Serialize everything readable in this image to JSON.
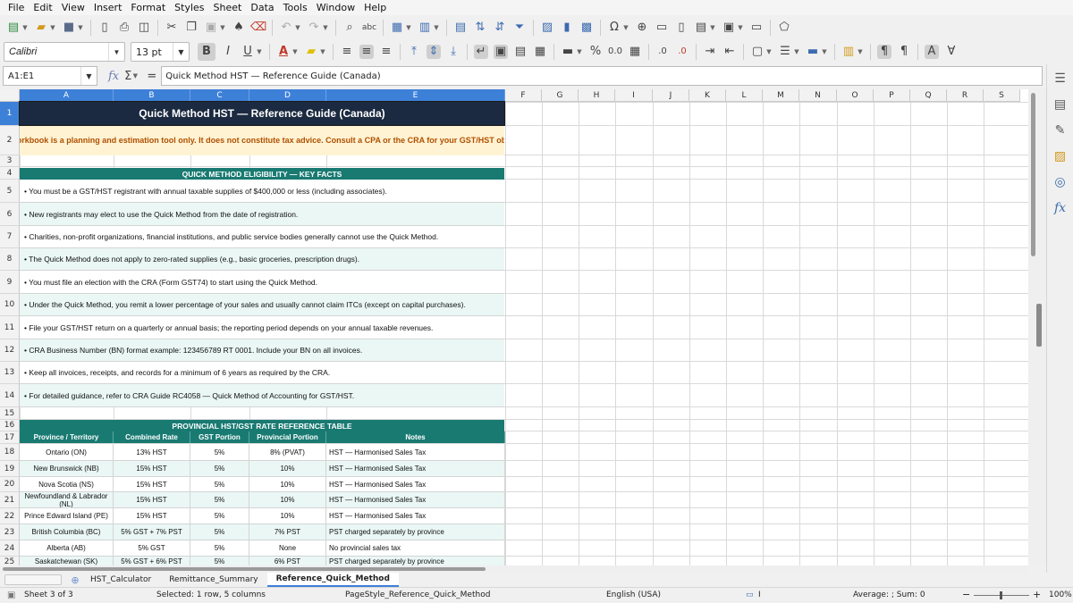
{
  "menu": [
    "File",
    "Edit",
    "View",
    "Insert",
    "Format",
    "Styles",
    "Sheet",
    "Data",
    "Tools",
    "Window",
    "Help"
  ],
  "toolbar": {
    "font_name": "Calibri",
    "font_size": "13 pt",
    "bold_label": "B",
    "italic_label": "I",
    "underline_label": "U",
    "percent_label": "%",
    "decimal_label": "0.0"
  },
  "formula_bar": {
    "cell_ref": "A1:E1",
    "content": "Quick Method HST — Reference Guide (Canada)"
  },
  "columns": [
    "A",
    "B",
    "C",
    "D",
    "E",
    "F",
    "G",
    "H",
    "I",
    "J",
    "K",
    "L",
    "M",
    "N",
    "O",
    "P",
    "Q",
    "R",
    "S"
  ],
  "rows": [
    "1",
    "2",
    "3",
    "4",
    "5",
    "6",
    "7",
    "8",
    "9",
    "10",
    "11",
    "12",
    "13",
    "14",
    "15",
    "16",
    "17",
    "18",
    "19",
    "20",
    "21",
    "22",
    "23",
    "24",
    "25"
  ],
  "sheet": {
    "title": "Quick Method HST — Reference Guide (Canada)",
    "warning": "⚠  This workbook is a planning and estimation tool only. It does not constitute tax advice. Consult a CPA or the CRA for your GST/HST obligations.",
    "eligibility_heading": "QUICK METHOD ELIGIBILITY — KEY FACTS",
    "eligibility": [
      "• You must be a GST/HST registrant with annual taxable supplies of $400,000 or less (including associates).",
      "• New registrants may elect to use the Quick Method from the date of registration.",
      "• Charities, non-profit organizations, financial institutions, and public service bodies generally cannot use the Quick Method.",
      "• The Quick Method does not apply to zero-rated supplies (e.g., basic groceries, prescription drugs).",
      "• You must file an election with the CRA (Form GST74) to start using the Quick Method.",
      "• Under the Quick Method, you remit a lower percentage of your sales and usually cannot claim ITCs (except on capital purchases).",
      "• File your GST/HST return on a quarterly or annual basis; the reporting period depends on your annual taxable revenues.",
      "• CRA Business Number (BN) format example: 123456789 RT 0001. Include your BN on all invoices.",
      "• Keep all invoices, receipts, and records for a minimum of 6 years as required by the CRA.",
      "• For detailed guidance, refer to CRA Guide RC4058 — Quick Method of Accounting for GST/HST."
    ],
    "rate_heading": "PROVINCIAL HST/GST RATE REFERENCE TABLE",
    "rate_headers": [
      "Province / Territory",
      "Combined Rate",
      "GST Portion",
      "Provincial Portion",
      "Notes"
    ],
    "rate_rows": [
      [
        "Ontario (ON)",
        "13% HST",
        "5%",
        "8% (PVAT)",
        "HST — Harmonised Sales Tax"
      ],
      [
        "New Brunswick (NB)",
        "15% HST",
        "5%",
        "10%",
        "HST — Harmonised Sales Tax"
      ],
      [
        "Nova Scotia (NS)",
        "15% HST",
        "5%",
        "10%",
        "HST — Harmonised Sales Tax"
      ],
      [
        "Newfoundland & Labrador (NL)",
        "15% HST",
        "5%",
        "10%",
        "HST — Harmonised Sales Tax"
      ],
      [
        "Prince Edward Island (PE)",
        "15% HST",
        "5%",
        "10%",
        "HST — Harmonised Sales Tax"
      ],
      [
        "British Columbia (BC)",
        "5% GST + 7% PST",
        "5%",
        "7% PST",
        "PST charged separately by province"
      ],
      [
        "Alberta (AB)",
        "5% GST",
        "5%",
        "None",
        "No provincial sales tax"
      ],
      [
        "Saskatchewan (SK)",
        "5% GST + 6% PST",
        "5%",
        "6% PST",
        "PST charged separately by province"
      ]
    ]
  },
  "tabs": [
    "HST_Calculator",
    "Remittance_Summary",
    "Reference_Quick_Method"
  ],
  "status": {
    "sheet": "Sheet 3 of 3",
    "selection": "Selected: 1 row, 5 columns",
    "page_style": "PageStyle_Reference_Quick_Method",
    "language": "English (USA)",
    "summary": "Average: ; Sum: 0",
    "zoom": "100%"
  },
  "colors": {
    "selection": "#3d80d8",
    "title_bg": "#1b2a40",
    "section_bg": "#197a72",
    "warning_bg": "#fff3d3",
    "warning_text": "#b05000",
    "alt_row": "#eaf7f5"
  }
}
